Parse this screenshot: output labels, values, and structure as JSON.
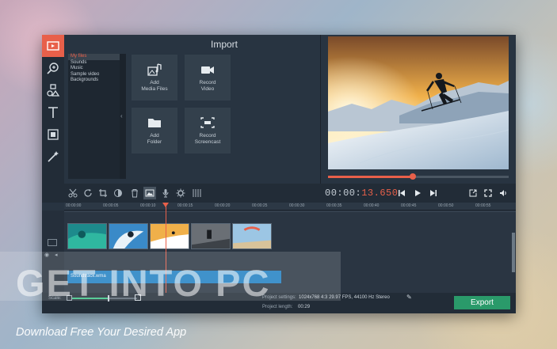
{
  "import": {
    "title": "Import",
    "files": [
      "My files",
      "Sounds",
      "Music",
      "Sample video",
      "Backgrounds"
    ],
    "tiles": [
      {
        "label": "Add\nMedia Files",
        "icon": "media-files-icon"
      },
      {
        "label": "Record\nVideo",
        "icon": "camera-icon"
      },
      {
        "label": "Add\nFolder",
        "icon": "folder-icon"
      },
      {
        "label": "Record\nScreencast",
        "icon": "screencast-icon"
      }
    ],
    "collapse_glyph": "‹"
  },
  "player": {
    "time_dim": "00:00:",
    "time_hi": "13.650",
    "progress": 0.47
  },
  "timeline": {
    "ticks": [
      "00:00:00",
      "00:00:05",
      "00:00:10",
      "00:00:15",
      "00:00:20",
      "00:00:25",
      "00:00:30",
      "00:00:35",
      "00:00:40",
      "00:00:45",
      "00:00:50",
      "00:00:55"
    ],
    "audio_label": "Soundtrack.wma"
  },
  "bottom": {
    "scale_label": "Scale:",
    "settings_label": "Project settings:",
    "settings_value": "1024x768 4:3 29.97 FPS, 44100 Hz Stereo",
    "length_label": "Project length:",
    "length_value": "00:29",
    "export_label": "Export"
  },
  "watermark": {
    "text": "GET INTO PC",
    "tagline": "Download Free Your Desired App"
  },
  "colors": {
    "accent": "#e8604a",
    "export": "#2a9a6a",
    "audio": "#1f7fc2"
  }
}
